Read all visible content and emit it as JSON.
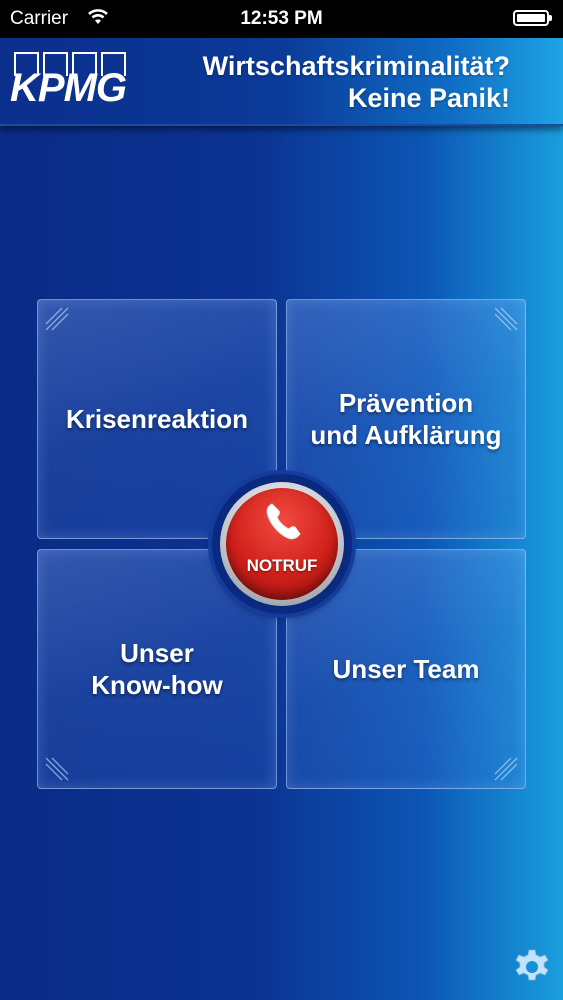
{
  "status_bar": {
    "carrier": "Carrier",
    "time": "12:53 PM"
  },
  "header": {
    "logo_text": "KPMG",
    "title_line1": "Wirtschaftskriminalität?",
    "title_line2": "Keine Panik!"
  },
  "tiles": [
    {
      "label": "Krisenreaktion"
    },
    {
      "label_line1": "Prävention",
      "label_line2": "und Aufklärung"
    },
    {
      "label_line1": "Unser",
      "label_line2": "Know-how"
    },
    {
      "label": "Unser Team"
    }
  ],
  "emergency": {
    "label": "NOTRUF",
    "icon": "phone-icon"
  },
  "settings_icon": "gear-icon",
  "colors": {
    "brand_blue": "#0b3392",
    "accent_cyan": "#1a9ede",
    "emergency_red": "#d0201a"
  }
}
